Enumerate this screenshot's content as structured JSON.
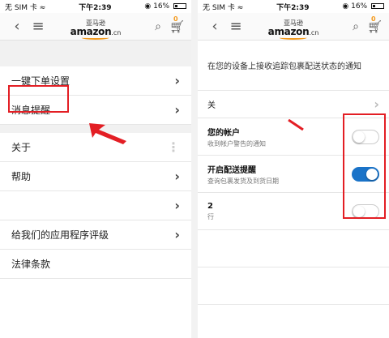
{
  "status": {
    "carrier": "无 SIM 卡",
    "time": "下午2:39",
    "battery": "16%"
  },
  "nav": {
    "logo_text": "amazon",
    "logo_cn": ".cn",
    "logo_small": "亚马逊",
    "cart_count": "0"
  },
  "left_menu": {
    "items": [
      {
        "label": "一键下单设置"
      },
      {
        "label": "消息提醒"
      },
      {
        "label": "关于"
      },
      {
        "label": "帮助"
      },
      {
        "label": ""
      },
      {
        "label": "给我们的应用程序评级"
      },
      {
        "label": "法律条款"
      }
    ]
  },
  "right_settings": {
    "intro": "在您的设备上接收追踪包裹配送状态的通知",
    "rows": [
      {
        "title": "关",
        "subtitle": ""
      },
      {
        "title": "您的帐户",
        "subtitle": "收到帐户警告的通知",
        "enabled": false
      },
      {
        "title": "开启配送提醒",
        "subtitle": "查询包裹发货及到货日期",
        "enabled": true
      },
      {
        "title": "2",
        "subtitle": "行",
        "enabled": false
      }
    ]
  },
  "colors": {
    "highlight": "#e31e24",
    "toggle_on": "#1a73c8",
    "logo_smile": "#f39a1e"
  }
}
